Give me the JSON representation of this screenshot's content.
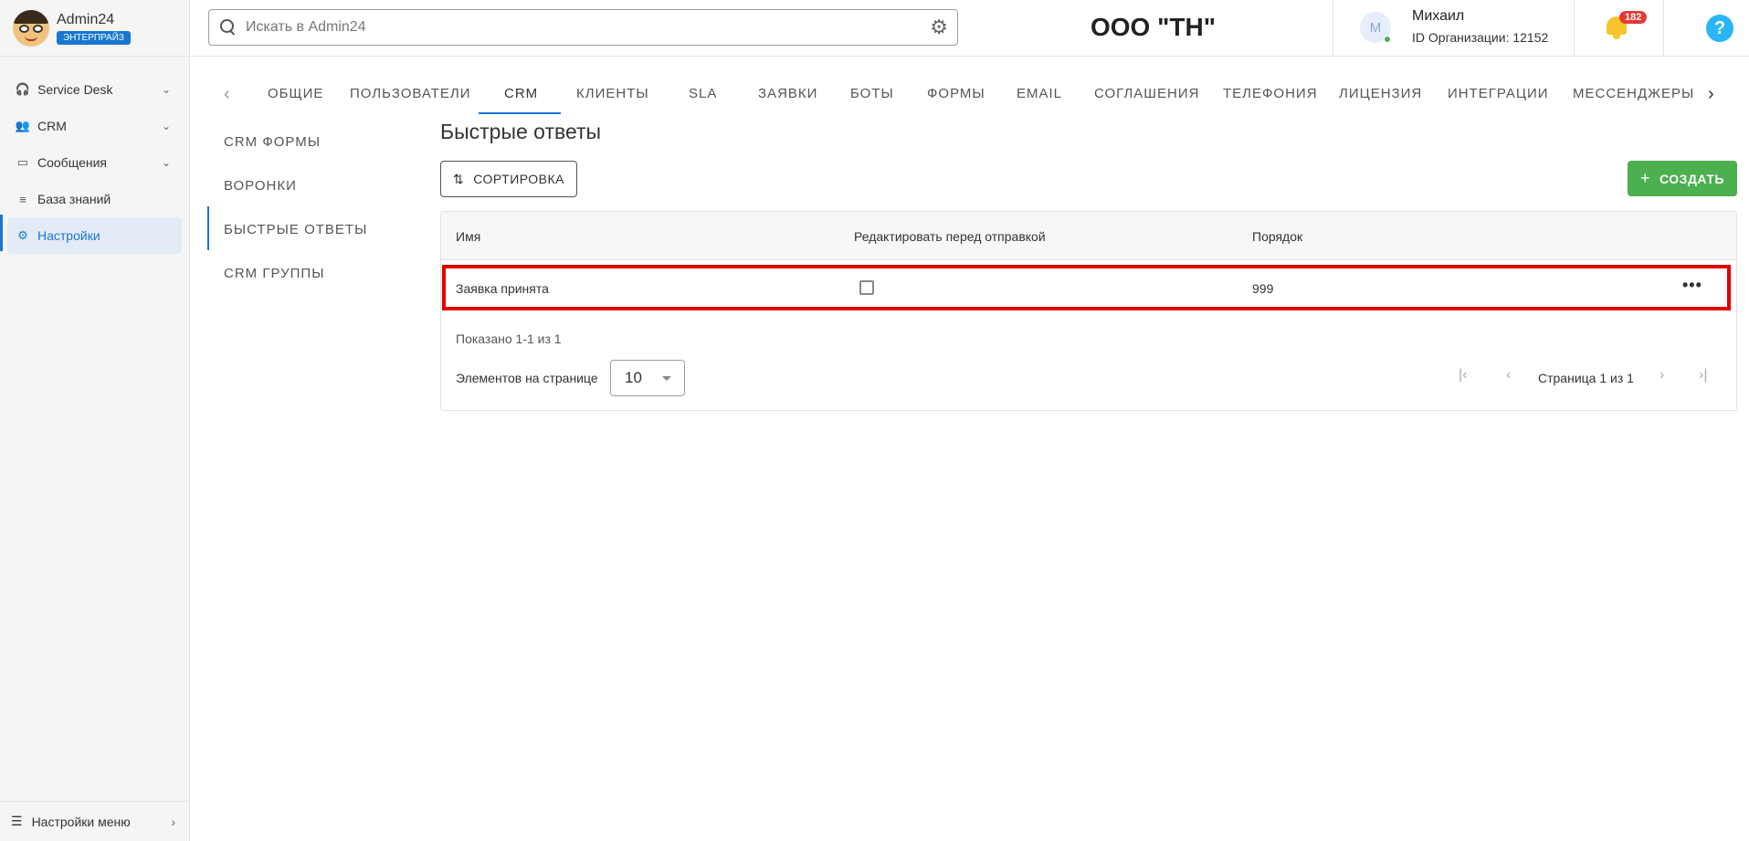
{
  "app": {
    "name": "Admin24",
    "edition": "ЭНТЕРПРАЙЗ"
  },
  "sidebar": {
    "items": [
      {
        "label": "Service Desk",
        "icon": "headset-icon"
      },
      {
        "label": "CRM",
        "icon": "users-icon"
      },
      {
        "label": "Сообщения",
        "icon": "chat-icon"
      },
      {
        "label": "База знаний",
        "icon": "database-icon"
      },
      {
        "label": "Настройки",
        "icon": "gear-icon",
        "active": true
      }
    ],
    "footer_label": "Настройки меню"
  },
  "header": {
    "search_placeholder": "Искать в Admin24",
    "org_title": "ООО \"ТН\"",
    "user_initial": "М",
    "user_name": "Михаил",
    "user_org": "ID Организации: 12152",
    "notification_count": "182",
    "help_label": "?"
  },
  "tabs": [
    {
      "label": "ОБЩИЕ"
    },
    {
      "label": "ПОЛЬЗОВАТЕЛИ"
    },
    {
      "label": "CRM",
      "active": true
    },
    {
      "label": "КЛИЕНТЫ"
    },
    {
      "label": "SLA"
    },
    {
      "label": "ЗАЯВКИ"
    },
    {
      "label": "БОТЫ"
    },
    {
      "label": "ФОРМЫ"
    },
    {
      "label": "EMAIL"
    },
    {
      "label": "СОГЛАШЕНИЯ"
    },
    {
      "label": "ТЕЛЕФОНИЯ"
    },
    {
      "label": "ЛИЦЕНЗИЯ"
    },
    {
      "label": "ИНТЕГРАЦИИ"
    },
    {
      "label": "МЕССЕНДЖЕРЫ"
    }
  ],
  "subnav": [
    {
      "label": "CRM ФОРМЫ"
    },
    {
      "label": "ВОРОНКИ"
    },
    {
      "label": "БЫСТРЫЕ ОТВЕТЫ",
      "active": true
    },
    {
      "label": "CRM ГРУППЫ"
    }
  ],
  "page": {
    "title": "Быстрые ответы",
    "sort_label": "СОРТИРОВКА",
    "create_label": "СОЗДАТЬ"
  },
  "table": {
    "columns": [
      "Имя",
      "Редактировать перед отправкой",
      "Порядок"
    ],
    "rows": [
      {
        "name": "Заявка принята",
        "edit_before_send": false,
        "order": "999"
      }
    ],
    "shown_text": "Показано 1-1 из 1",
    "per_page_label": "Элементов на странице",
    "per_page_value": "10",
    "page_label": "Страница 1 из 1"
  },
  "colors": {
    "accent": "#1976d2",
    "create_button": "#4caf50",
    "highlight_border": "#e00000",
    "badge": "#e53935"
  }
}
